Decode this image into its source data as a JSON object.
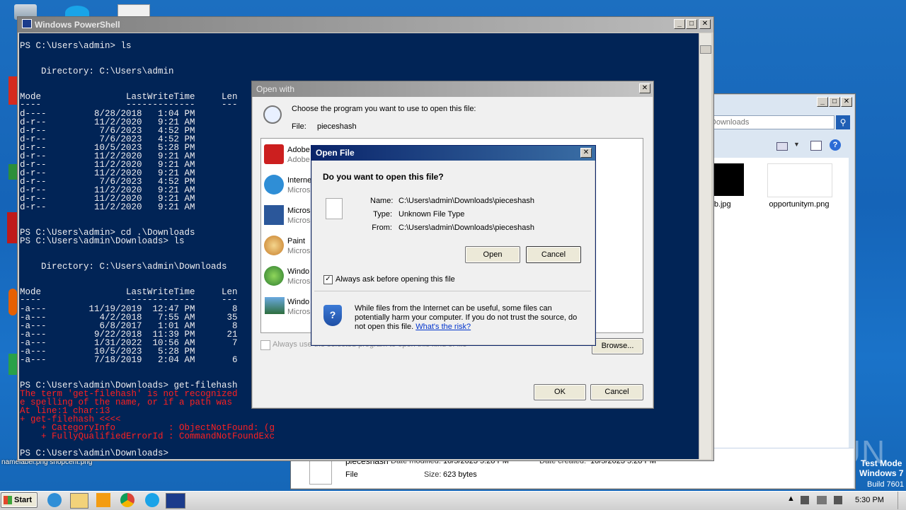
{
  "powershell": {
    "title": "Windows PowerShell",
    "lines": [
      "PS C:\\Users\\admin> ls",
      "    Directory: C:\\Users\\admin",
      "Mode                LastWriteTime     Len",
      "----                -------------     ---",
      "d----         8/28/2018   1:04 PM",
      "d-r--         11/2/2020   9:21 AM",
      "d-r--          7/6/2023   4:52 PM",
      "d-r--          7/6/2023   4:52 PM",
      "d-r--         10/5/2023   5:28 PM",
      "d-r--         11/2/2020   9:21 AM",
      "d-r--         11/2/2020   9:21 AM",
      "d-r--         11/2/2020   9:21 AM",
      "d-r--          7/6/2023   4:52 PM",
      "d-r--         11/2/2020   9:21 AM",
      "d-r--         11/2/2020   9:21 AM",
      "d-r--         11/2/2020   9:21 AM",
      "PS C:\\Users\\admin> cd .\\Downloads",
      "PS C:\\Users\\admin\\Downloads> ls",
      "    Directory: C:\\Users\\admin\\Downloads",
      "Mode                LastWriteTime     Len",
      "----                -------------     ---",
      "-a---        11/19/2019  12:47 PM       8",
      "-a---          4/2/2018   7:55 AM      35",
      "-a---          6/8/2017   1:01 AM       8",
      "-a---         9/22/2018  11:39 PM      21",
      "-a---         1/31/2022  10:56 AM       7",
      "-a---         10/5/2023   5:28 PM",
      "-a---         7/18/2019   2:04 AM       6",
      "PS C:\\Users\\admin\\Downloads> get-filehash",
      "The term 'get-filehash' is not recognized",
      "e spelling of the name, or if a path was",
      "At line:1 char:13",
      "+ get-filehash <<<<",
      "    + CategoryInfo          : ObjectNotFound: (g",
      "    + FullyQualifiedErrorId : CommandNotFoundExc",
      "PS C:\\Users\\admin\\Downloads>"
    ]
  },
  "explorer": {
    "search_placeholder": "Search Downloads",
    "files": [
      {
        "name": "lordmb.jpg"
      },
      {
        "name": "opportunitym.png"
      }
    ],
    "details": {
      "filename": "pieceshash",
      "type": "File",
      "date_modified_label": "Date modified:",
      "date_modified": "10/5/2023 5:28 PM",
      "date_created_label": "Date created:",
      "date_created": "10/5/2023 5:28 PM",
      "size_label": "Size:",
      "size": "623 bytes"
    }
  },
  "open_with": {
    "title": "Open with",
    "prompt": "Choose the program you want to use to open this file:",
    "file_label": "File:",
    "file_name": "pieceshash",
    "programs": [
      {
        "name": "Adobe",
        "sub": "Adobe"
      },
      {
        "name": "Interne",
        "sub": "Micros"
      },
      {
        "name": "Micros",
        "sub": "Micros"
      },
      {
        "name": "Paint",
        "sub": "Micros"
      },
      {
        "name": "Windo",
        "sub": "Micros"
      },
      {
        "name": "Windo",
        "sub": "Micros"
      }
    ],
    "always_use_label": "Always use the selected program to open this kind of file",
    "browse_label": "Browse...",
    "ok_label": "OK",
    "cancel_label": "Cancel"
  },
  "open_file": {
    "title": "Open File",
    "question": "Do you want to open this file?",
    "name_label": "Name:",
    "name_value": "C:\\Users\\admin\\Downloads\\pieceshash",
    "type_label": "Type:",
    "type_value": "Unknown File Type",
    "from_label": "From:",
    "from_value": "C:\\Users\\admin\\Downloads\\pieceshash",
    "open_label": "Open",
    "cancel_label": "Cancel",
    "always_ask_label": "Always ask before opening this file",
    "always_ask_checked": true,
    "warning_text": "While files from the Internet can be useful, some files can potentially harm your computer. If you do not trust the source, do not open this file.",
    "risk_link": "What's the risk?"
  },
  "desktop": {
    "bottom_text": "namelabel.png   shopcent.png",
    "watermark": "ANY RUN",
    "test_mode_line1": "Test Mode",
    "test_mode_line2": "Windows 7",
    "test_mode_line3": "Build 7601"
  },
  "taskbar": {
    "start_label": "Start",
    "clock": "5:30 PM"
  }
}
